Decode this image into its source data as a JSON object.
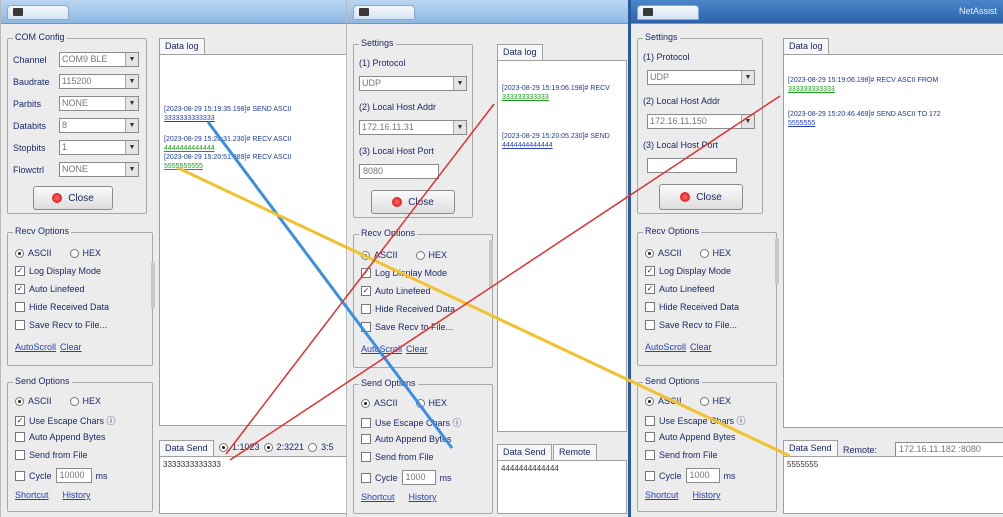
{
  "w1": {
    "title": "",
    "com_config": {
      "title": "COM Config",
      "rows": [
        {
          "label": "Channel",
          "value": "COM9 BLE"
        },
        {
          "label": "Baudrate",
          "value": "115200"
        },
        {
          "label": "Parbits",
          "value": "NONE"
        },
        {
          "label": "Databits",
          "value": "8"
        },
        {
          "label": "Stopbits",
          "value": "1"
        },
        {
          "label": "Flowctrl",
          "value": "NONE"
        }
      ]
    },
    "close_label": "Close",
    "recv": {
      "title": "Recv Options",
      "ascii": "ASCII",
      "hex": "HEX",
      "opts": [
        "Log Display Mode",
        "Auto Linefeed",
        "Hide Received Data",
        "Save Recv to File..."
      ],
      "autosave": "AutoScroll",
      "clear": "Clear"
    },
    "send": {
      "title": "Send Options",
      "ascii": "ASCII",
      "hex": "HEX",
      "opts": [
        "Use Escape Chars ⓘ",
        "Auto Append Bytes",
        "Send from File"
      ],
      "cycle_label": "Cycle",
      "cycle_value": "10000",
      "cycle_unit": "ms",
      "shortcut": "Shortcut",
      "history": "History"
    },
    "log_tab": "Data log",
    "log": [
      {
        "head": "[2023-08-29 15:19:35.198]# SEND ASCII",
        "data": "3333333333333"
      },
      {
        "head": "[2023-08-29 15:20:31.230]# RECV ASCII",
        "data": "4444444444444"
      },
      {
        "head": "[2023-08-29 15:20:51.989]# RECV ASCII",
        "data": "5555555555"
      }
    ],
    "datasend_tab": "Data Send",
    "targets": [
      "1:1023",
      "2:3221",
      "3:5"
    ],
    "send_text": "3333333333333"
  },
  "w2": {
    "title": "",
    "settings": {
      "title": "Settings",
      "protocol_label": "(1) Protocol",
      "protocol": "UDP",
      "host_label": "(2) Local Host Addr",
      "host": "172.16.11.31",
      "port_label": "(3) Local Host Port",
      "port": "8080"
    },
    "close_label": "Close",
    "recv": {
      "title": "Recv Options",
      "ascii": "ASCII",
      "hex": "HEX",
      "opts": [
        "Log Display Mode",
        "Auto Linefeed",
        "Hide Received Data",
        "Save Recv to File..."
      ],
      "autosave": "AutoScroll",
      "clear": "Clear"
    },
    "send": {
      "title": "Send Options",
      "ascii": "ASCII",
      "hex": "HEX",
      "opts": [
        "Use Escape Chars ⓘ",
        "Auto Append Bytes",
        "Send from File"
      ],
      "cycle_label": "Cycle",
      "cycle_value": "1000",
      "cycle_unit": "ms",
      "shortcut": "Shortcut",
      "history": "History"
    },
    "log_tab": "Data log",
    "log": [
      {
        "head": "[2023-08-29 15:19:06.198]# RECV",
        "data": "333333333333"
      },
      {
        "head": "[2023-08-29 15:20:05.230]# SEND",
        "data": "4444444444444"
      }
    ],
    "datasend_tab": "Data Send",
    "remote_tab": "Remote",
    "send_text": "4444444444444"
  },
  "w3": {
    "title": "NetAssist",
    "settings": {
      "title": "Settings",
      "protocol_label": "(1) Protocol",
      "protocol": "UDP",
      "host_label": "(2) Local Host Addr",
      "host": "172.16.11.150",
      "port_label": "(3) Local Host Port",
      "port": ""
    },
    "close_label": "Close",
    "recv": {
      "title": "Recv Options",
      "ascii": "ASCII",
      "hex": "HEX",
      "opts": [
        "Log Display Mode",
        "Auto Linefeed",
        "Hide Received Data",
        "Save Recv to File..."
      ],
      "autosave": "AutoScroll",
      "clear": "Clear"
    },
    "send": {
      "title": "Send Options",
      "ascii": "ASCII",
      "hex": "HEX",
      "opts": [
        "Use Escape Chars ⓘ",
        "Auto Append Bytes",
        "Send from File"
      ],
      "cycle_label": "Cycle",
      "cycle_value": "1000",
      "cycle_unit": "ms",
      "shortcut": "Shortcut",
      "history": "History"
    },
    "log_tab": "Data log",
    "log": [
      {
        "head": "[2023-08-29 15:19:06.198]# RECV ASCII FROM",
        "data": "333333333333"
      },
      {
        "head": "[2023-08-29 15:20:46.469]# SEND ASCII TO 172",
        "data": "5555555"
      }
    ],
    "datasend_tab": "Data Send",
    "remote_label": "Remote:",
    "remote_value": "172.16.11.182 :8080",
    "send_text": "5555555"
  },
  "connectors": [
    {
      "color": "#3b8fe0",
      "name": "blue-connector"
    },
    {
      "color": "#f2c12e",
      "name": "yellow-connector"
    },
    {
      "color": "#e03030",
      "name": "red-connector-a"
    },
    {
      "color": "#e03030",
      "name": "red-connector-b"
    }
  ]
}
